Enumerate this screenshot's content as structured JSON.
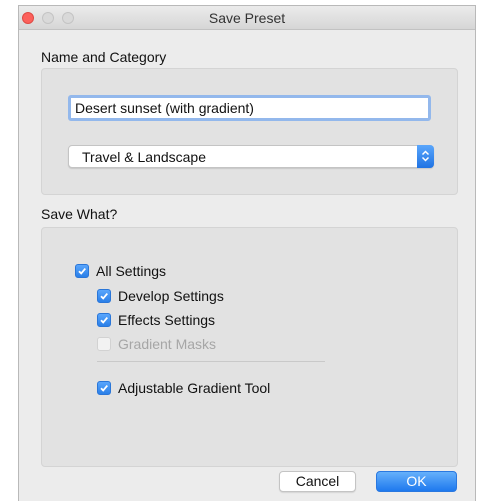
{
  "window": {
    "title": "Save Preset"
  },
  "name_section": {
    "label": "Name and Category",
    "name_value": "Desert sunset (with gradient)",
    "category_selected": "Travel & Landscape"
  },
  "save_section": {
    "label": "Save What?",
    "options": [
      {
        "label": "All Settings",
        "checked": true,
        "enabled": true
      },
      {
        "label": "Develop Settings",
        "checked": true,
        "enabled": true
      },
      {
        "label": "Effects Settings",
        "checked": true,
        "enabled": true
      },
      {
        "label": "Gradient Masks",
        "checked": false,
        "enabled": false
      },
      {
        "label": "Adjustable Gradient Tool",
        "checked": true,
        "enabled": true
      }
    ]
  },
  "buttons": {
    "cancel": "Cancel",
    "ok": "OK"
  },
  "colors": {
    "accent": "#2a7fe8",
    "close_button": "#fc605b",
    "disabled_text": "#a6a6a6"
  }
}
